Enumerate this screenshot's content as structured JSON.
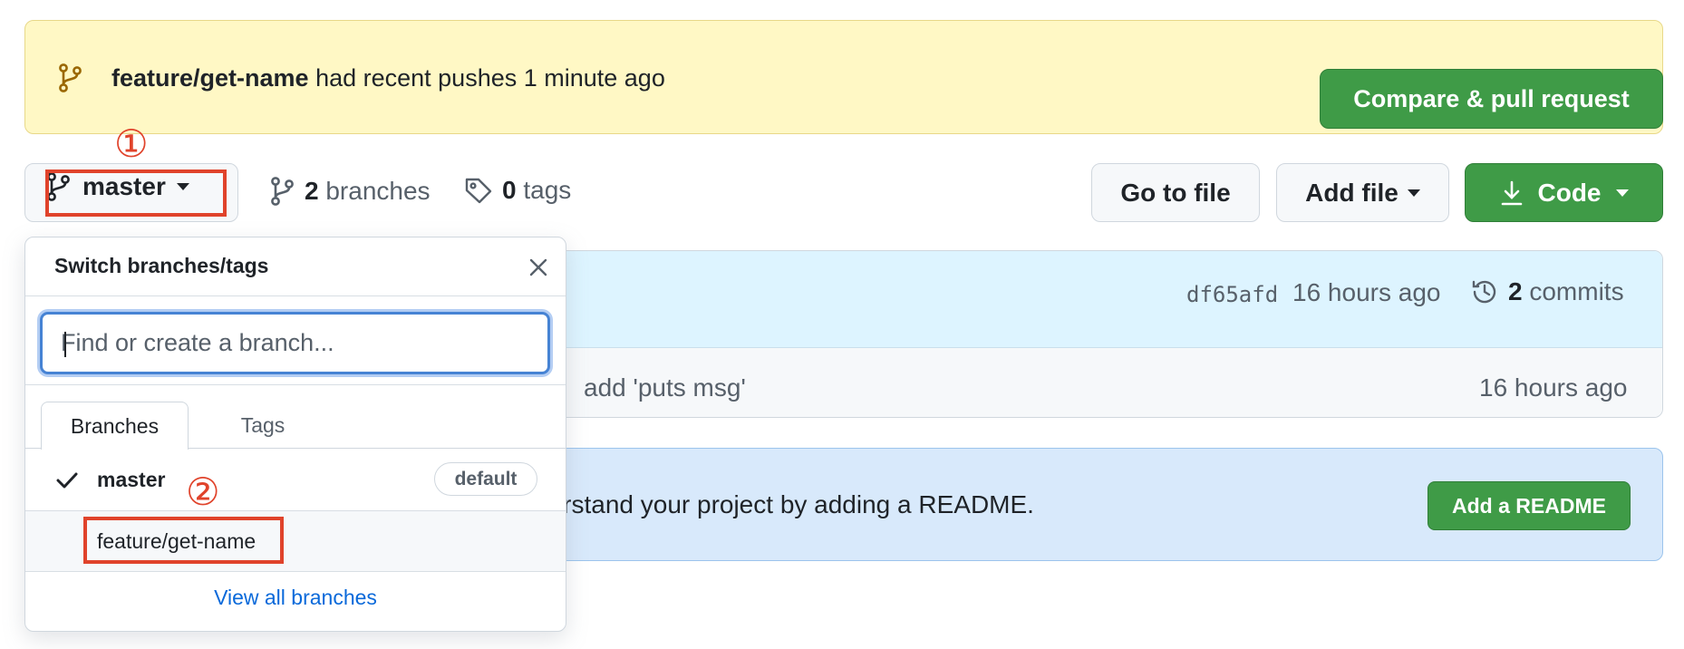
{
  "banner": {
    "branch": "feature/get-name",
    "message": " had recent pushes 1 minute ago",
    "compare_button": "Compare & pull request"
  },
  "toolbar": {
    "branch_button": "master",
    "branches_count": "2",
    "branches_label": "branches",
    "tags_count": "0",
    "tags_label": "tags",
    "go_to_file": "Go to file",
    "add_file": "Add file",
    "code": "Code"
  },
  "commit": {
    "sha": "df65afd",
    "time": "16 hours ago",
    "commits_count": "2",
    "commits_label": "commits",
    "file_row_message": "add 'puts msg'",
    "file_row_time": "16 hours ago"
  },
  "readme": {
    "text": "derstand your project by adding a README.",
    "button": "Add a README"
  },
  "dropdown": {
    "title": "Switch branches/tags",
    "search_placeholder": "Find or create a branch...",
    "tabs": [
      "Branches",
      "Tags"
    ],
    "branches": [
      {
        "name": "master",
        "badge": "default",
        "selected": true
      },
      {
        "name": "feature/get-name",
        "badge": "",
        "selected": false
      }
    ],
    "view_all": "View all branches"
  },
  "annotations": {
    "marker_1": "①",
    "marker_2": "②"
  },
  "colors": {
    "accent_green": "#3f9b47",
    "annotation_red": "#e0432b",
    "banner_yellow": "#fff8c5",
    "link_blue": "#0969da"
  }
}
